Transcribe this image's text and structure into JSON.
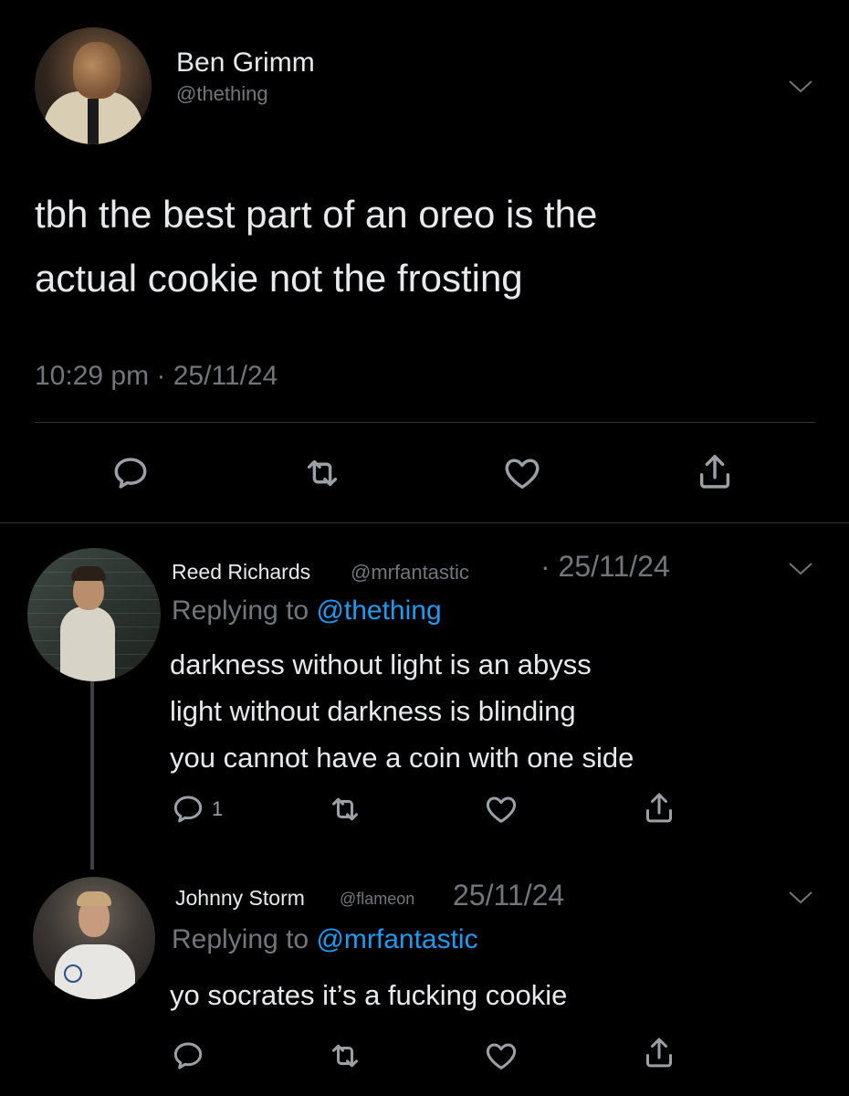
{
  "main_tweet": {
    "author_name": "Ben Grimm",
    "author_handle": "@thething",
    "text_lines": [
      "tbh the best part of an oreo is the",
      "actual cookie not the frosting"
    ],
    "timestamp": "10:29 pm · 25/11/24"
  },
  "replies": [
    {
      "author_name": "Reed Richards",
      "author_handle": "@mrfantastic",
      "date": "· 25/11/24",
      "replying_prefix": "Replying to ",
      "replying_to": "@thething",
      "text_lines": [
        "darkness without light is an abyss",
        "light without darkness is blinding",
        "you cannot have a coin with one side"
      ],
      "reply_count": "1"
    },
    {
      "author_name": "Johnny Storm",
      "author_handle": "@flameon",
      "date": "25/11/24",
      "replying_prefix": "Replying to ",
      "replying_to": "@mrfantastic",
      "text_lines": [
        "yo socrates it’s a fucking cookie"
      ]
    }
  ],
  "icons": {
    "reply": "comment-bubble-icon",
    "retweet": "retweet-icon",
    "like": "heart-icon",
    "share": "share-icon",
    "more": "chevron-down-icon"
  },
  "colors": {
    "background": "#000000",
    "text": "#e7e9ea",
    "secondary": "#71767b",
    "link": "#1d9bf0",
    "divider": "#2f3336"
  }
}
